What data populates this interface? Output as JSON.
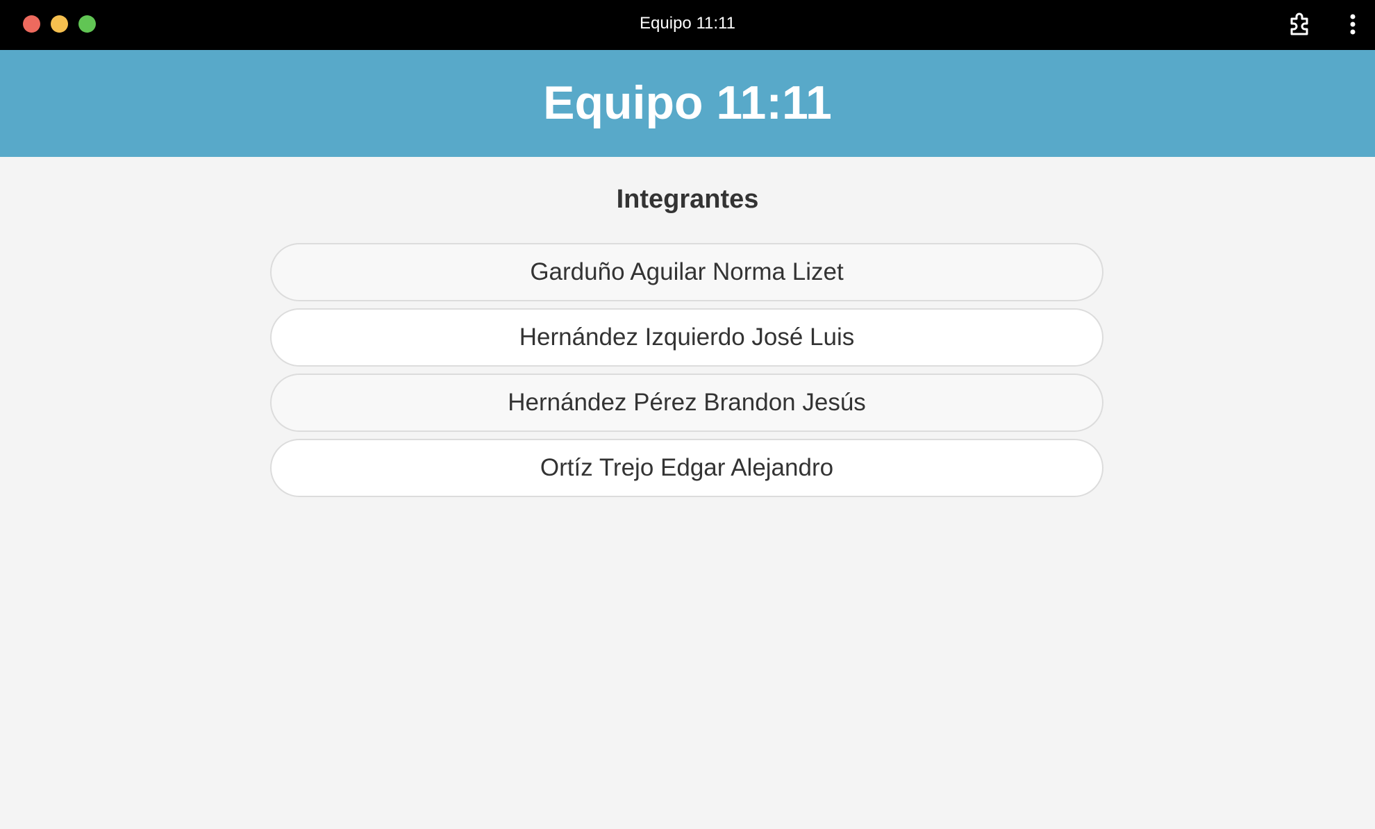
{
  "window": {
    "title": "Equipo 11:11",
    "controls": [
      "close",
      "minimize",
      "zoom"
    ],
    "icons": [
      "extension-icon",
      "more-vertical-icon"
    ]
  },
  "header": {
    "title": "Equipo 11:11",
    "background_color": "#58a9c9"
  },
  "main": {
    "heading": "Integrantes",
    "members": [
      "Garduño Aguilar Norma Lizet",
      "Hernández Izquierdo José Luis",
      "Hernández Pérez Brandon Jesús",
      "Ortíz Trejo Edgar Alejandro"
    ]
  }
}
